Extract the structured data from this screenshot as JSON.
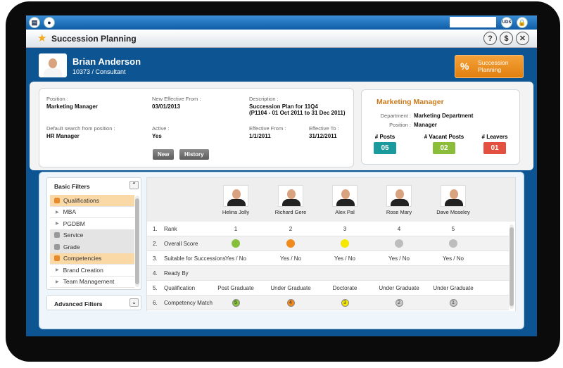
{
  "topbar": {
    "user_badge": "UDS"
  },
  "title": "Succession Planning",
  "title_buttons": [
    "?",
    "$",
    "✕"
  ],
  "employee": {
    "name": "Brian Anderson",
    "subtitle": "10373 / Consultant"
  },
  "module_button": {
    "label_line1": "Succession",
    "label_line2": "Planning"
  },
  "details": {
    "position_label": "Position :",
    "position": "Marketing Manager",
    "new_eff_label": "New Effective From :",
    "new_eff": "03/01/2013",
    "desc_label": "Description :",
    "desc_line1": "Succession Plan for 11Q4",
    "desc_line2": "(P1104 - 01 Oct 2011 to 31 Dec 2011)",
    "default_label": "Default search from position :",
    "default": "HR Manager",
    "active_label": "Active :",
    "active": "Yes",
    "eff_from_label": "Effective From :",
    "eff_from": "1/1/2011",
    "eff_to_label": "Effective To :",
    "eff_to": "31/12/2011",
    "new_btn": "New",
    "history_btn": "History"
  },
  "summary": {
    "title": "Marketing Manager",
    "dept_label": "Department :",
    "dept": "Marketing Department",
    "pos_label": "Position :",
    "pos": "Manager",
    "stats": [
      {
        "label": "# Posts",
        "value": "05",
        "color": "#1a9a9c"
      },
      {
        "label": "# Vacant Posts",
        "value": "02",
        "color": "#8cbd3a"
      },
      {
        "label": "# Leavers",
        "value": "01",
        "color": "#e3503f"
      }
    ]
  },
  "filters": {
    "basic": "Basic Filters",
    "advanced": "Advanced Filters",
    "items": [
      {
        "label": "Qualifications",
        "type": "group-open"
      },
      {
        "label": "MBA",
        "type": "child"
      },
      {
        "label": "PGDBM",
        "type": "child"
      },
      {
        "label": "Service",
        "type": "group-closed"
      },
      {
        "label": "Grade",
        "type": "group-closed"
      },
      {
        "label": "Competencies",
        "type": "group-open"
      },
      {
        "label": "Brand Creation",
        "type": "child"
      },
      {
        "label": "Team Management",
        "type": "child"
      }
    ]
  },
  "candidates": [
    "Helina Jolly",
    "Richard Gere",
    "Alex Pal",
    "Rose Mary",
    "Dave Moseley"
  ],
  "criteria": [
    {
      "num": "1.",
      "name": "Rank",
      "values": [
        "1",
        "2",
        "3",
        "4",
        "5"
      ]
    },
    {
      "num": "2.",
      "name": "Overall Score",
      "colors": [
        "#86bf3a",
        "#f08a1c",
        "#f5e800",
        "#bdbdbd",
        "#bdbdbd"
      ]
    },
    {
      "num": "3.",
      "name": "Suitable for Successions",
      "values": [
        "Yes / No",
        "Yes / No",
        "Yes / No",
        "Yes / No",
        "Yes / No"
      ]
    },
    {
      "num": "4.",
      "name": "Ready By",
      "values": [
        "",
        "",
        "",
        "",
        ""
      ]
    },
    {
      "num": "5.",
      "name": "Qualification",
      "values": [
        "Post Graduate",
        "Under Graduate",
        "Doctorate",
        "Under Graduate",
        "Under Graduate"
      ]
    },
    {
      "num": "6.",
      "name": "Competency Match",
      "values": [
        "5",
        "4",
        "3",
        "2",
        "1"
      ],
      "colors": [
        "#86bf3a",
        "#f08a1c",
        "#f5e800",
        "#c8c8c8",
        "#c8c8c8"
      ]
    }
  ]
}
